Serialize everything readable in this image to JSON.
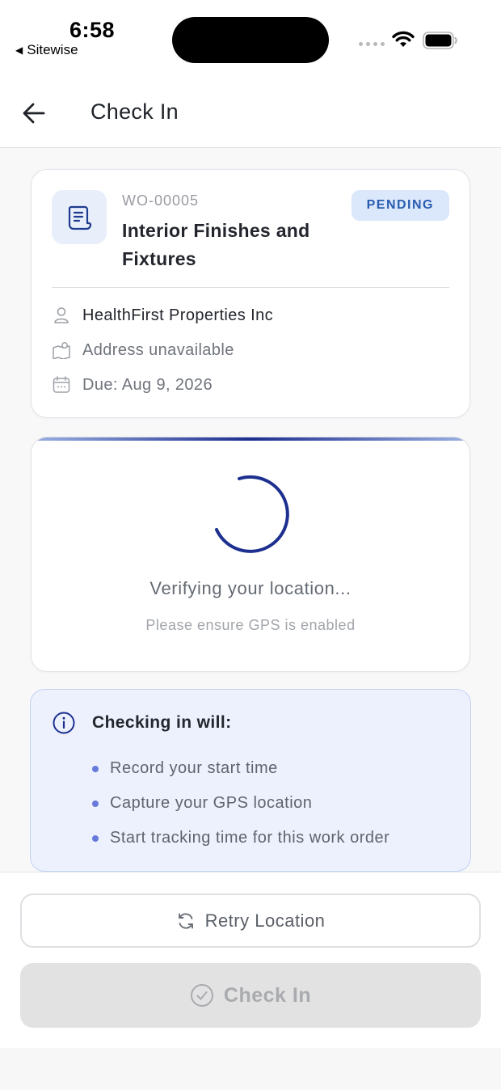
{
  "status_bar": {
    "time": "6:58",
    "back_app": "Sitewise",
    "back_app_glyph": "◀"
  },
  "header": {
    "title": "Check In",
    "back_icon": "arrow-left-icon"
  },
  "work_order": {
    "number": "WO-00005",
    "title": "Interior Finishes and Fixtures",
    "status": "PENDING",
    "customer": "HealthFirst Properties Inc",
    "address": "Address unavailable",
    "due": "Due: Aug 9, 2026"
  },
  "location": {
    "title": "Verifying your location...",
    "subtitle": "Please ensure GPS is enabled"
  },
  "info": {
    "title": "Checking in will:",
    "items": [
      "Record your start time",
      "Capture your GPS location",
      "Start tracking time for this work order"
    ]
  },
  "actions": {
    "retry_label": "Retry Location",
    "checkin_label": "Check In"
  },
  "colors": {
    "accent": "#1d2f8f",
    "badge_bg": "#dbe7fb",
    "badge_text": "#2a5db0",
    "info_bg": "#ecf1fd",
    "disabled_bg": "#e2e2e3"
  }
}
